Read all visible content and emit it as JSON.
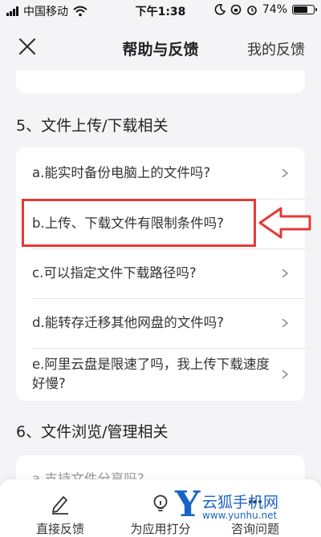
{
  "status_bar": {
    "carrier": "中国移动",
    "time": "下午1:38",
    "battery": "74%",
    "battery_level": 0.74
  },
  "nav": {
    "title": "帮助与反馈",
    "mine_label": "我的反馈"
  },
  "sections": [
    {
      "heading": "5、文件上传/下载相关",
      "items": [
        "a.能实时备份电脑上的文件吗?",
        "b.上传、下载文件有限制条件吗?",
        "c.可以指定文件下载路径吗?",
        "d.能转存迁移其他网盘的文件吗?",
        "e.阿里云盘是限速了吗，我上传下载速度好慢?"
      ]
    },
    {
      "heading": "6、文件浏览/管理相关",
      "items": [
        "a.支持文件分享吗?"
      ]
    }
  ],
  "bottom_tabs": [
    {
      "label": "直接反馈",
      "icon": "pen-icon"
    },
    {
      "label": "为应用打分",
      "icon": "lightbulb-icon"
    },
    {
      "label": "咨询问题",
      "icon": "chat-icon"
    }
  ],
  "watermark": {
    "letter": "Y",
    "name": "云狐手机网",
    "url": "www.yunhu.net"
  },
  "colors": {
    "highlight": "#e53935",
    "watermark": "#1a63c6"
  }
}
